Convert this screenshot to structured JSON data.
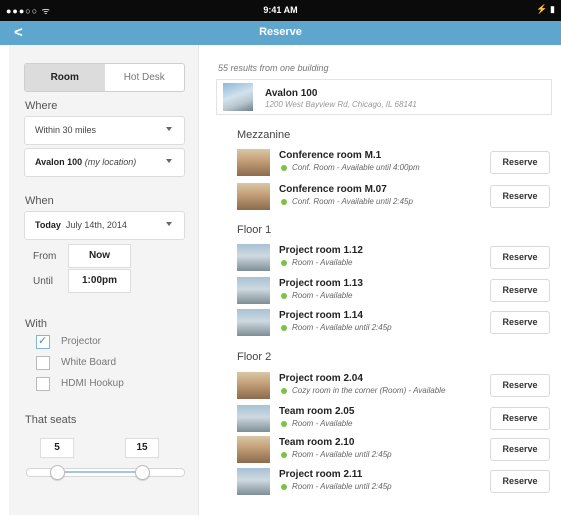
{
  "status_bar": {
    "signal": "●●●○○ ᯤ",
    "time": "9:41 AM",
    "battery": "⚡ ▮"
  },
  "nav": {
    "back": "<",
    "title": "Reserve"
  },
  "filters": {
    "tabs": [
      "Room",
      "Hot Desk"
    ],
    "active_tab": "Room",
    "where_label": "Where",
    "distance": "Within 30 miles",
    "location_name": "Avalon 100",
    "location_note": "(my location)",
    "when_label": "When",
    "date_prefix": "Today",
    "date": "July 14th, 2014",
    "from_label": "From",
    "from_value": "Now",
    "until_label": "Until",
    "until_value": "1:00pm",
    "with_label": "With",
    "amenities": [
      {
        "label": "Projector",
        "checked": true
      },
      {
        "label": "White Board",
        "checked": false
      },
      {
        "label": "HDMI Hookup",
        "checked": false
      }
    ],
    "seats_label": "That seats",
    "seats_min": "5",
    "seats_max": "15"
  },
  "results": {
    "count_text": "55 results from one building",
    "building": {
      "name": "Avalon 100",
      "address": "1200 West Bayview Rd, Chicago, IL 68141"
    },
    "sections": [
      {
        "title": "Mezzanine",
        "rooms": [
          {
            "name": "Conference room M.1",
            "desc": "Conf. Room - Available until 4:00pm",
            "button": "Reserve"
          },
          {
            "name": "Conference room M.07",
            "desc": "Conf. Room - Available until 2:45p",
            "button": "Reserve"
          }
        ]
      },
      {
        "title": "Floor 1",
        "rooms": [
          {
            "name": "Project room 1.12",
            "desc": "Room - Available",
            "button": "Reserve"
          },
          {
            "name": "Project room 1.13",
            "desc": "Room - Available",
            "button": "Reserve"
          },
          {
            "name": "Project room 1.14",
            "desc": "Room - Available until 2:45p",
            "button": "Reserve"
          }
        ]
      },
      {
        "title": "Floor 2",
        "rooms": [
          {
            "name": "Project room 2.04",
            "desc": "Cozy room in the corner (Room) - Available",
            "button": "Reserve"
          },
          {
            "name": "Team room 2.05",
            "desc": "Room - Available",
            "button": "Reserve"
          },
          {
            "name": "Team room 2.10",
            "desc": "Room - Available until 2:45p",
            "button": "Reserve"
          },
          {
            "name": "Project room 2.11",
            "desc": "Room - Available until 2:45p",
            "button": "Reserve"
          }
        ]
      }
    ]
  },
  "colors": {
    "nav_bar": "#5fa6cf",
    "available_dot": "#7cc243"
  }
}
